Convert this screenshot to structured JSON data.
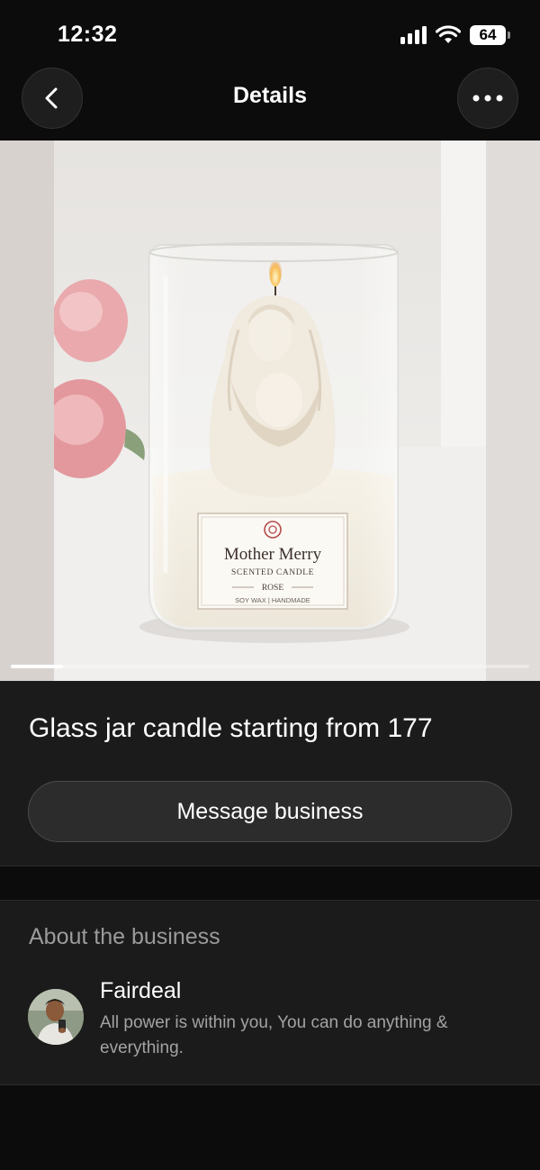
{
  "status_bar": {
    "time": "12:32",
    "battery": "64",
    "icons": [
      "signal-icon",
      "wifi-icon",
      "battery-icon"
    ]
  },
  "header": {
    "title": "Details",
    "back_icon": "chevron-left-icon",
    "more_icon": "more-horizontal-icon"
  },
  "product_image": {
    "label_brand": "Mother Merry",
    "label_line1": "SCENTED CANDLE",
    "label_line2": "ROSE",
    "label_line3": "SOY WAX  |  HANDMADE",
    "carousel_progress": 0.1
  },
  "product": {
    "title": "Glass jar candle starting from 177",
    "message_button": "Message business"
  },
  "about": {
    "heading": "About the business",
    "business_name": "Fairdeal",
    "description": "All power is within you, You can do anything & everything."
  },
  "colors": {
    "background": "#0c0c0c",
    "card": "#1b1b1b",
    "button": "#2c2c2c",
    "muted_text": "#9b9b9b"
  }
}
